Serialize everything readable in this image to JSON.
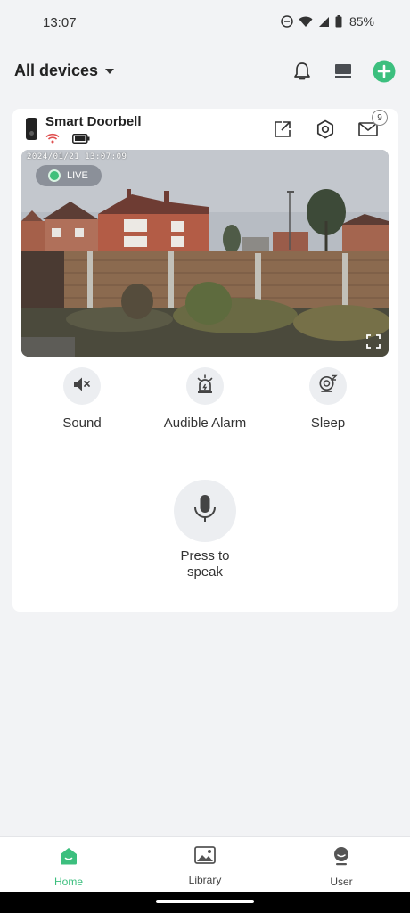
{
  "status_bar": {
    "time": "13:07",
    "battery_text": "85%"
  },
  "header": {
    "title": "All devices",
    "icons": [
      "bell-icon",
      "monitor-icon",
      "add-icon"
    ],
    "accent_color": "#3cbf7e"
  },
  "device_card": {
    "name": "Smart Doorbell",
    "status_icons": [
      "wifi-icon",
      "battery-icon"
    ],
    "actions": [
      "share-icon",
      "settings-icon",
      "mail-icon"
    ],
    "mail_badge_count": "9",
    "video": {
      "timestamp": "2024/01/21 13:07:09",
      "live_label": "LIVE"
    },
    "controls": [
      {
        "label": "Sound",
        "icon": "speaker-muted-icon"
      },
      {
        "label": "Audible Alarm",
        "icon": "alarm-icon"
      },
      {
        "label": "Sleep",
        "icon": "sleep-camera-icon"
      }
    ],
    "speak_label": "Press to speak"
  },
  "bottom_nav": {
    "items": [
      {
        "label": "Home",
        "icon": "home-icon",
        "active": true
      },
      {
        "label": "Library",
        "icon": "image-icon",
        "active": false
      },
      {
        "label": "User",
        "icon": "user-icon",
        "active": false
      }
    ]
  }
}
